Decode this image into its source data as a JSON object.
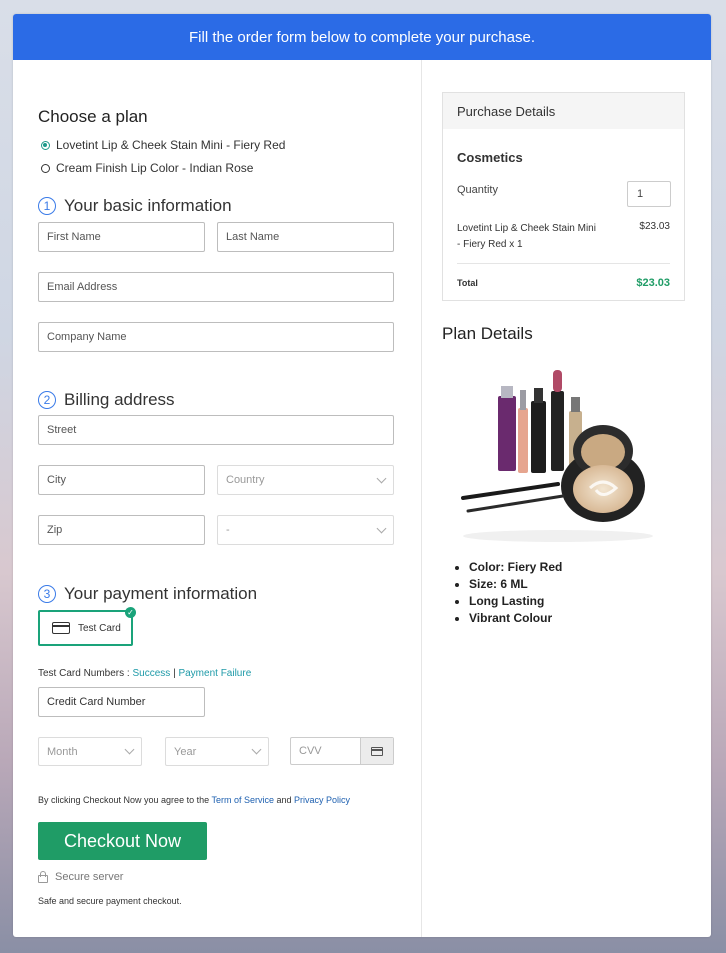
{
  "banner": "Fill the order form below to complete your purchase.",
  "plan": {
    "title": "Choose a plan",
    "options": [
      {
        "label": "Lovetint Lip & Cheek Stain Mini - Fiery Red",
        "selected": true
      },
      {
        "label": "Cream Finish Lip Color - Indian Rose",
        "selected": false
      }
    ]
  },
  "basic": {
    "number": "1",
    "title": "Your basic information",
    "first_name": "First Name",
    "last_name": "Last Name",
    "email": "Email Address",
    "company": "Company Name"
  },
  "billing": {
    "number": "2",
    "title": "Billing address",
    "street": "Street",
    "city": "City",
    "country": "Country",
    "zip": "Zip",
    "state": "-"
  },
  "payment": {
    "number": "3",
    "title": "Your payment information",
    "test_card": "Test Card",
    "test_numbers_label": "Test Card Numbers :",
    "success": "Success",
    "separator": "|",
    "failure": "Payment Failure",
    "card_number": "Credit Card Number",
    "month": "Month",
    "year": "Year",
    "cvv": "CVV"
  },
  "terms": {
    "prefix": "By clicking Checkout Now you agree to the",
    "terms_link": "Term of Service",
    "and": "and",
    "privacy_link": "Privacy Policy"
  },
  "checkout_button": "Checkout Now",
  "secure_label": "Secure server",
  "safe_label": "Safe and secure payment checkout.",
  "purchase": {
    "title": "Purchase Details",
    "category": "Cosmetics",
    "quantity_label": "Quantity",
    "quantity": "1",
    "item": "Lovetint Lip & Cheek Stain Mini - Fiery Red x 1",
    "price": "$23.03",
    "total_label": "Total",
    "total": "$23.03"
  },
  "plan_details": {
    "title": "Plan Details",
    "features": [
      "Color: Fiery Red",
      "Size: 6 ML",
      "Long Lasting",
      "Vibrant Colour"
    ]
  },
  "colors": {
    "banner": "#2b6be6",
    "accent_green": "#1f9c66",
    "link_teal": "#1e9aa8",
    "step_blue": "#3a7be8"
  }
}
